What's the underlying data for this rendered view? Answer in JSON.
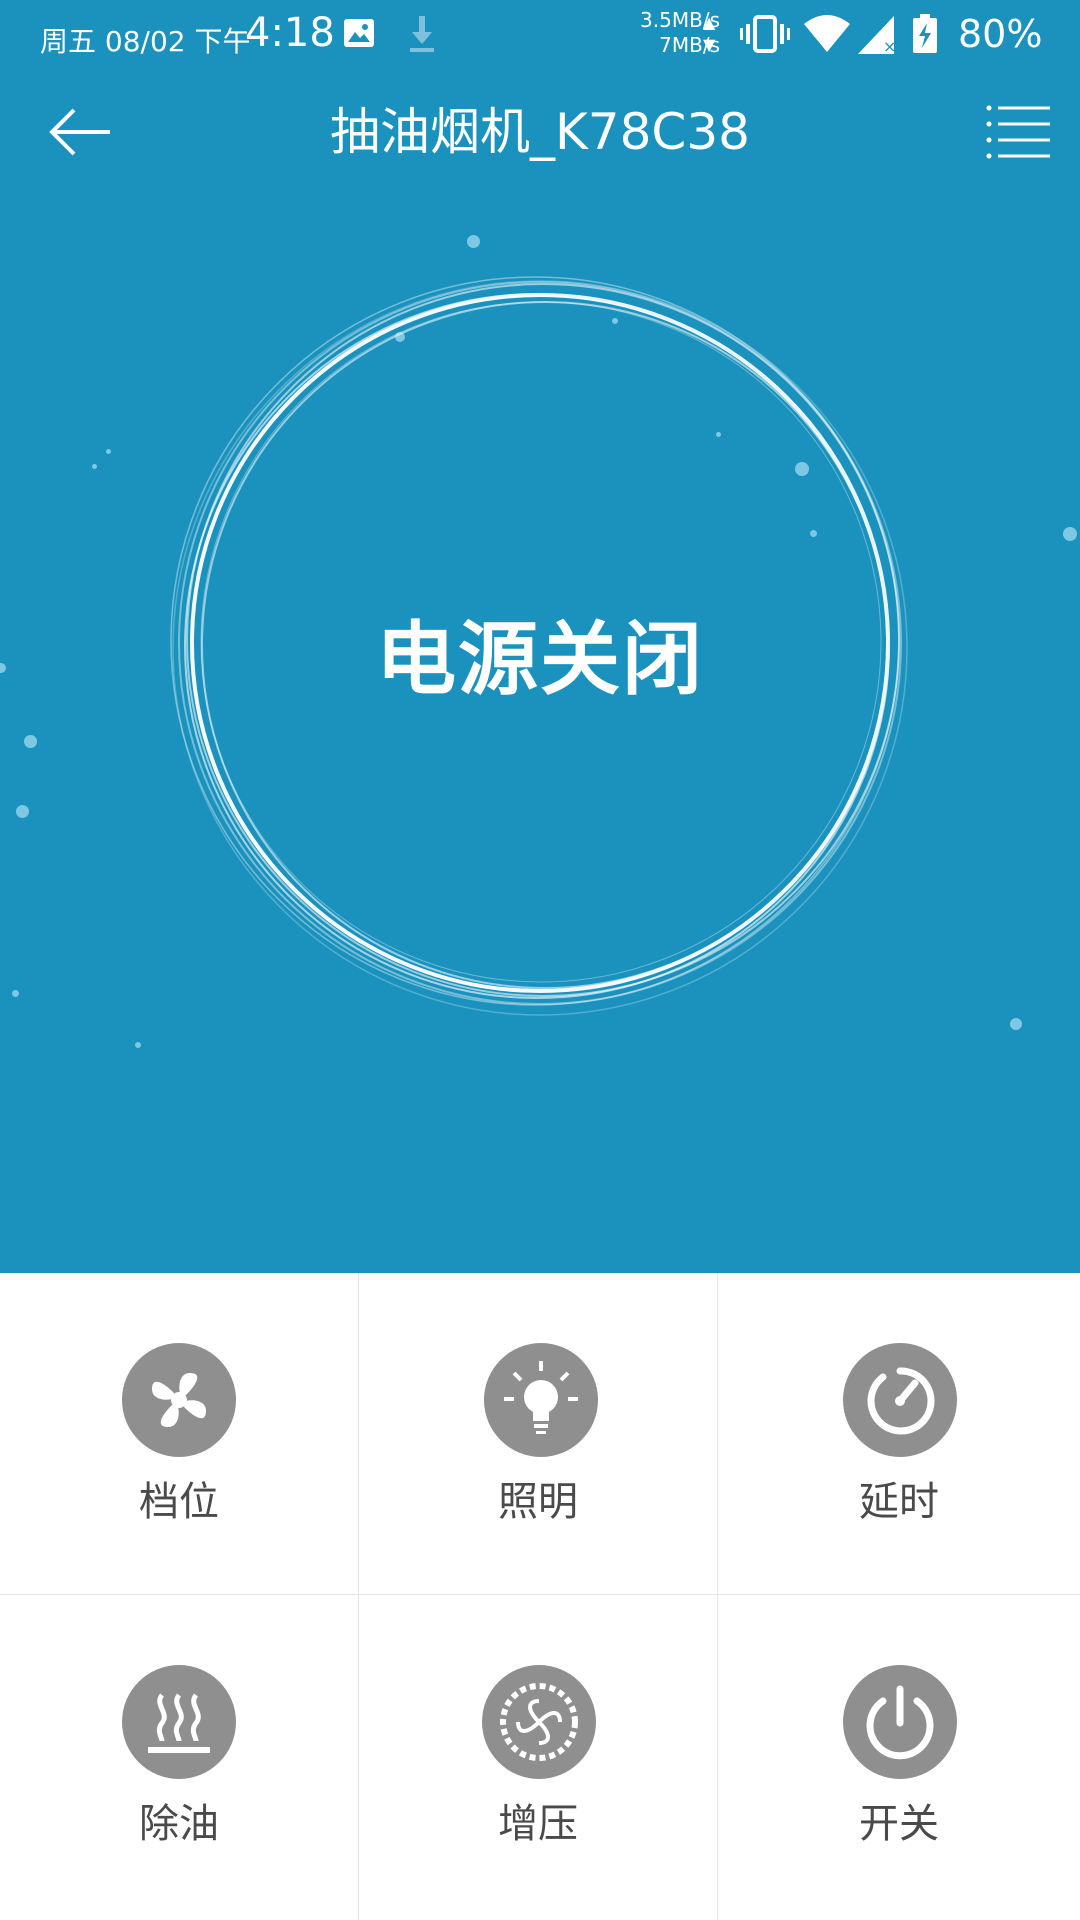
{
  "status_bar": {
    "date": "周五 08/02 下午",
    "time": "4:18",
    "net_up": "3.5MB/s",
    "net_down": "7MB/s",
    "battery": "80%"
  },
  "header": {
    "title": "抽油烟机_K78C38"
  },
  "main": {
    "power_state": "电源关闭"
  },
  "controls": [
    {
      "label": "档位",
      "icon": "fan-icon"
    },
    {
      "label": "照明",
      "icon": "lightbulb-icon"
    },
    {
      "label": "延时",
      "icon": "timer-icon"
    },
    {
      "label": "除油",
      "icon": "steam-icon"
    },
    {
      "label": "增压",
      "icon": "boost-icon"
    },
    {
      "label": "开关",
      "icon": "power-icon"
    }
  ],
  "colors": {
    "header_bg": "#1a92bd",
    "icon_bg": "#8f8f8f",
    "label_text": "#4a4a4a"
  }
}
